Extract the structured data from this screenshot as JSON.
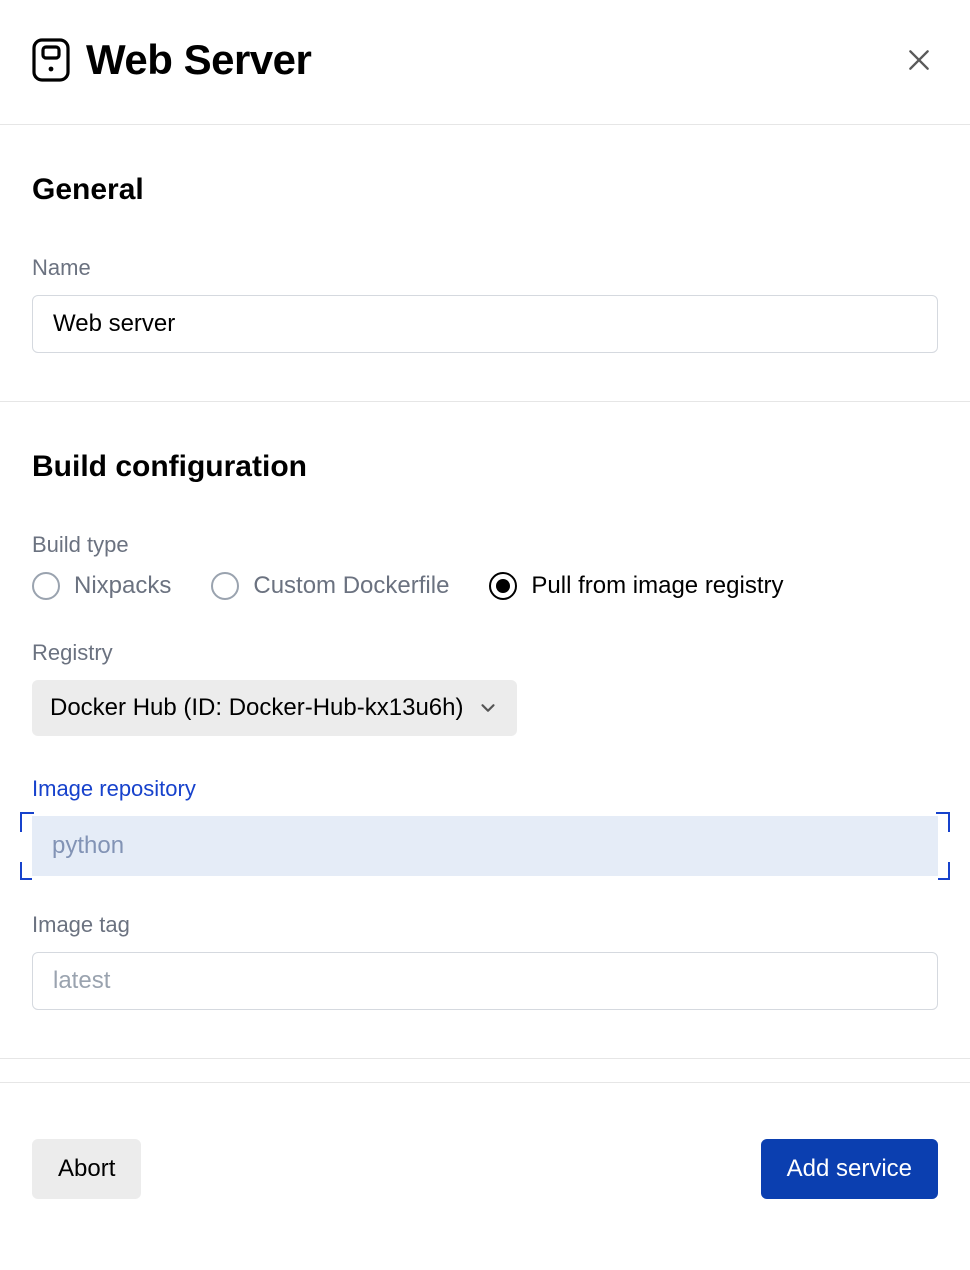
{
  "header": {
    "title": "Web Server"
  },
  "general": {
    "section_title": "General",
    "name_label": "Name",
    "name_value": "Web server"
  },
  "build": {
    "section_title": "Build configuration",
    "type_label": "Build type",
    "options": [
      {
        "label": "Nixpacks",
        "selected": false
      },
      {
        "label": "Custom Dockerfile",
        "selected": false
      },
      {
        "label": "Pull from image registry",
        "selected": true
      }
    ],
    "registry_label": "Registry",
    "registry_value": "Docker Hub (ID: Docker-Hub-kx13u6h)",
    "image_repo_label": "Image repository",
    "image_repo_placeholder": "python",
    "image_repo_value": "",
    "image_tag_label": "Image tag",
    "image_tag_placeholder": "latest",
    "image_tag_value": ""
  },
  "footer": {
    "abort_label": "Abort",
    "submit_label": "Add service"
  }
}
